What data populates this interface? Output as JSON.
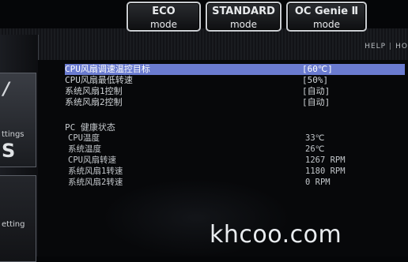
{
  "modes": {
    "eco": {
      "line1": "ECO",
      "line2": "mode"
    },
    "standard": {
      "line1": "STANDARD",
      "line2": "mode"
    },
    "oc_genie": {
      "line1": "OC Genie Ⅱ",
      "line2": "mode"
    }
  },
  "helpbar": {
    "help": "HELP",
    "sep": "|",
    "next": "HO"
  },
  "sidebar": {
    "settings_label": "ttings",
    "settings_letter": "S",
    "oc_label": "etting"
  },
  "fan_settings": [
    {
      "label": "CPU风扇调速温控目标",
      "value": "[60℃]"
    },
    {
      "label": "CPU风扇最低转速",
      "value": "[50%]"
    },
    {
      "label": "系统风扇1控制",
      "value": "[自动]"
    },
    {
      "label": "系统风扇2控制",
      "value": "[自动]"
    }
  ],
  "health": {
    "title": "PC 健康状态",
    "items": [
      {
        "label": "CPU温度",
        "value": "33℃"
      },
      {
        "label": "系统温度",
        "value": "26℃"
      },
      {
        "label": "CPU风扇转速",
        "value": "1267 RPM"
      },
      {
        "label": "系统风扇1转速",
        "value": "1180 RPM"
      },
      {
        "label": "系统风扇2转速",
        "value": "0 RPM"
      }
    ]
  },
  "watermark": "khcoo.com",
  "colors": {
    "selected_row": "#6a7bd0",
    "background": "#050608"
  }
}
